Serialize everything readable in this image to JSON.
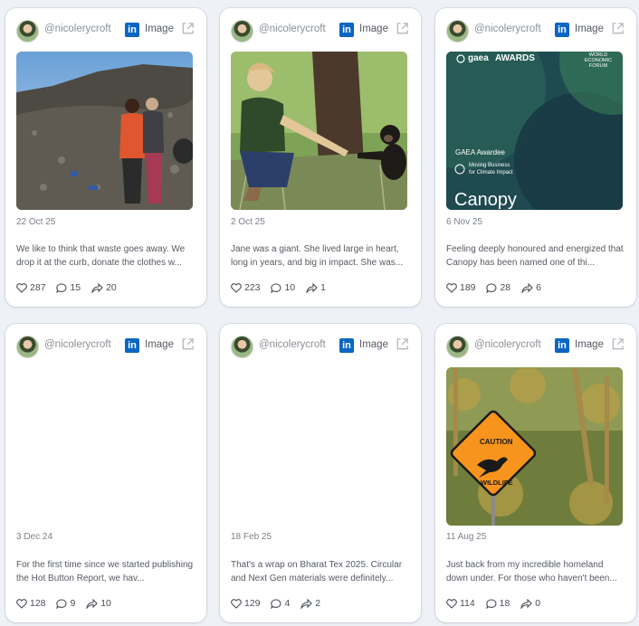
{
  "posts": [
    {
      "user": "@nicolerycroft",
      "network": "in",
      "type": "Image",
      "date": "22 Oct 25",
      "text": "We like to think that waste goes away. We drop it at the curb, donate the clothes w...",
      "likes": "287",
      "comments": "15",
      "shares": "20",
      "image": "waste-dump-photo"
    },
    {
      "user": "@nicolerycroft",
      "network": "in",
      "type": "Image",
      "date": "2 Oct 25",
      "text": "Jane was a giant. She lived large in heart, long in years, and big in impact. She was...",
      "likes": "223",
      "comments": "10",
      "shares": "1",
      "image": "chimpanzee-photo"
    },
    {
      "user": "@nicolerycroft",
      "network": "in",
      "type": "Image",
      "date": "6 Nov 25",
      "text": "Feeling deeply honoured and energized that Canopy has been named one of thi...",
      "likes": "189",
      "comments": "28",
      "shares": "6",
      "image": "gaea-awards-graphic",
      "graphic": {
        "brand": "gaea",
        "awards": "AWARDS",
        "wef": "WORLD ECONOMIC FORUM",
        "awardee": "GAEA Awardee",
        "tagline1": "Moving Business",
        "tagline2": "for Climate Impact",
        "org": "Canopy"
      }
    },
    {
      "user": "@nicolerycroft",
      "network": "in",
      "type": "Image",
      "date": "3 Dec 24",
      "text": "For the first time since we started publishing the Hot Button Report, we hav...",
      "likes": "128",
      "comments": "9",
      "shares": "10",
      "image": ""
    },
    {
      "user": "@nicolerycroft",
      "network": "in",
      "type": "Image",
      "date": "18 Feb 25",
      "text": "That's a wrap on Bharat Tex 2025. Circular and Next Gen materials were definitely...",
      "likes": "129",
      "comments": "4",
      "shares": "2",
      "image": ""
    },
    {
      "user": "@nicolerycroft",
      "network": "in",
      "type": "Image",
      "date": "11 Aug 25",
      "text": "Just back from my incredible homeland down under. For those who haven't been...",
      "likes": "114",
      "comments": "18",
      "shares": "0",
      "image": "kangaroo-sign-photo",
      "sign": {
        "line1": "CAUTION",
        "line2": "WILDLIFE"
      }
    }
  ],
  "colors": {
    "linkedin": "#0a66c2",
    "background": "#eef1f6",
    "card": "#ffffff"
  }
}
